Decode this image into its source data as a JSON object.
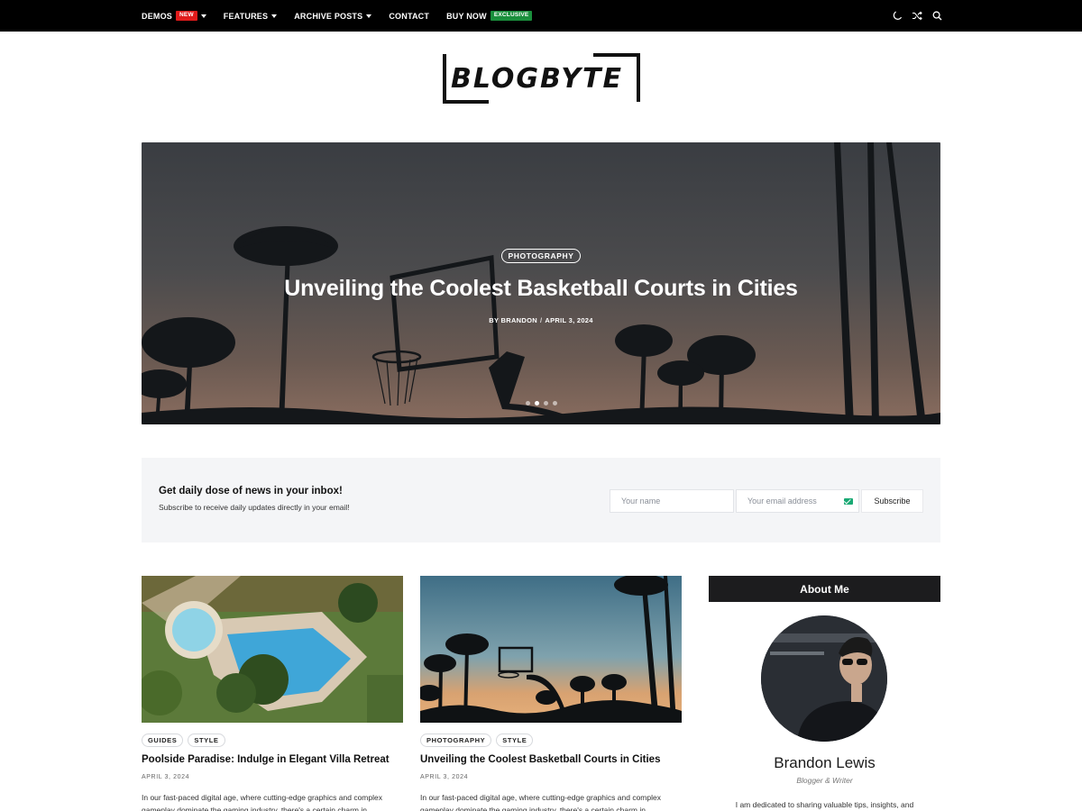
{
  "nav": {
    "items": [
      {
        "label": "DEMOS",
        "badge": "NEW",
        "badge_color": "#e01b1b",
        "dropdown": true
      },
      {
        "label": "FEATURES",
        "dropdown": true
      },
      {
        "label": "ARCHIVE POSTS",
        "dropdown": true
      },
      {
        "label": "CONTACT",
        "dropdown": false
      },
      {
        "label": "BUY NOW",
        "badge": "EXCLUSIVE",
        "badge_color": "#1a8f3c",
        "dropdown": false
      }
    ],
    "tools": [
      "moon-icon",
      "shuffle-icon",
      "search-icon"
    ]
  },
  "logo": {
    "text": "BLOGBYTE"
  },
  "hero": {
    "category": "PHOTOGRAPHY",
    "title": "Unveiling the Coolest Basketball Courts in Cities",
    "author": "BY BRANDON",
    "date": "APRIL 3, 2024",
    "slides": 4,
    "active_slide": 2
  },
  "newsletter": {
    "title": "Get daily dose of news in your inbox!",
    "subtitle": "Subscribe to receive daily updates directly in your email!",
    "name_placeholder": "Your name",
    "email_placeholder": "Your email address",
    "button": "Subscribe"
  },
  "posts": [
    {
      "tags": [
        "GUIDES",
        "STYLE"
      ],
      "title": "Poolside Paradise: Indulge in Elegant Villa Retreat",
      "date": "APRIL 3, 2024",
      "excerpt": "In our fast-paced digital age, where cutting-edge graphics and complex gameplay dominate the gaming industry, there's a certain charm in"
    },
    {
      "tags": [
        "PHOTOGRAPHY",
        "STYLE"
      ],
      "title": "Unveiling the Coolest Basketball Courts in Cities",
      "date": "APRIL 3, 2024",
      "excerpt": "In our fast-paced digital age, where cutting-edge graphics and complex gameplay dominate the gaming industry, there's a certain charm in"
    }
  ],
  "about": {
    "heading": "About Me",
    "name": "Brandon Lewis",
    "role": "Blogger & Writer",
    "text": "I am dedicated to sharing valuable tips, insights, and"
  }
}
